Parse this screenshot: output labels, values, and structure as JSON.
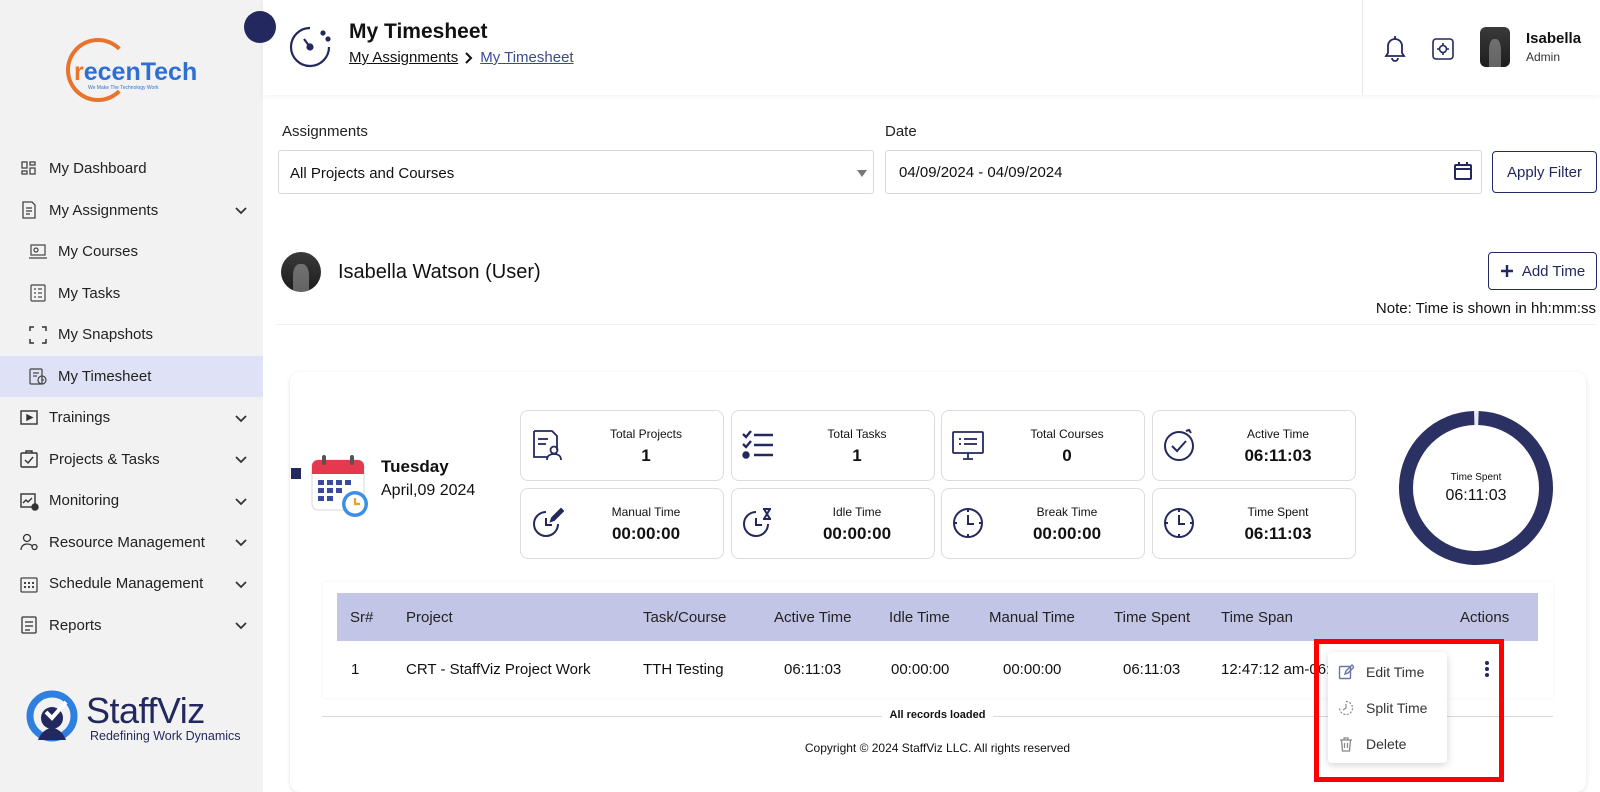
{
  "sidebar": {
    "logo": {
      "brand_pre": "r",
      "brand_main": "ecenTech",
      "tagline": "We Make The Technology Work"
    },
    "items": [
      {
        "label": "My Dashboard"
      },
      {
        "label": "My Assignments"
      },
      {
        "label": "My Courses"
      },
      {
        "label": "My Tasks"
      },
      {
        "label": "My Snapshots"
      },
      {
        "label": "My Timesheet"
      },
      {
        "label": "Trainings"
      },
      {
        "label": "Projects & Tasks"
      },
      {
        "label": "Monitoring"
      },
      {
        "label": "Resource Management"
      },
      {
        "label": "Schedule Management"
      },
      {
        "label": "Reports"
      }
    ],
    "footer_logo": {
      "name": "StaffViz",
      "tagline": "Redefining Work Dynamics"
    }
  },
  "header": {
    "title": "My Timesheet",
    "breadcrumb": [
      "My Assignments",
      "My Timesheet"
    ],
    "user": {
      "name": "Isabella",
      "role": "Admin"
    }
  },
  "filters": {
    "assignments_label": "Assignments",
    "assignments_value": "All Projects and Courses",
    "date_label": "Date",
    "date_value": "04/09/2024 - 04/09/2024",
    "apply_label": "Apply Filter"
  },
  "user_row": {
    "name": "Isabella Watson (User)",
    "add_time_label": "Add Time",
    "note": "Note: Time is shown in hh:mm:ss"
  },
  "day": {
    "weekday": "Tuesday",
    "date": "April,09 2024",
    "stats": [
      {
        "label": "Total Projects",
        "value": "1",
        "icon": "projects-icon"
      },
      {
        "label": "Total Tasks",
        "value": "1",
        "icon": "tasks-icon"
      },
      {
        "label": "Total Courses",
        "value": "0",
        "icon": "courses-icon"
      },
      {
        "label": "Active Time",
        "value": "06:11:03",
        "icon": "active-time-icon"
      },
      {
        "label": "Manual Time",
        "value": "00:00:00",
        "icon": "manual-time-icon"
      },
      {
        "label": "Idle Time",
        "value": "00:00:00",
        "icon": "idle-time-icon"
      },
      {
        "label": "Break Time",
        "value": "00:00:00",
        "icon": "break-time-icon"
      },
      {
        "label": "Time Spent",
        "value": "06:11:03",
        "icon": "time-spent-icon"
      }
    ],
    "donut": {
      "label": "Time Spent",
      "value": "06:11:03",
      "fill_fraction": 0.99,
      "color": "#2b3163"
    }
  },
  "table": {
    "columns": [
      "Sr#",
      "Project",
      "Task/Course",
      "Active Time",
      "Idle Time",
      "Manual Time",
      "Time Spent",
      "Time Span",
      "Actions"
    ],
    "rows": [
      [
        "1",
        "CRT - StaffViz Project Work",
        "TTH Testing",
        "06:11:03",
        "00:00:00",
        "00:00:00",
        "06:11:03",
        "12:47:12 am-06:"
      ]
    ],
    "footer": "All records loaded"
  },
  "context_menu": {
    "items": [
      {
        "label": "Edit Time",
        "icon": "edit-icon"
      },
      {
        "label": "Split Time",
        "icon": "split-time-icon"
      },
      {
        "label": "Delete",
        "icon": "trash-icon"
      }
    ]
  },
  "copyright": "Copyright © 2024 StaffViz LLC. All rights reserved",
  "colors": {
    "primary": "#23295e",
    "table_header": "#c3c5e6",
    "active_nav": "#dfe1f7",
    "highlight": "#ff0000",
    "logo_orange": "#e8732c",
    "logo_blue": "#2f6fd1"
  }
}
